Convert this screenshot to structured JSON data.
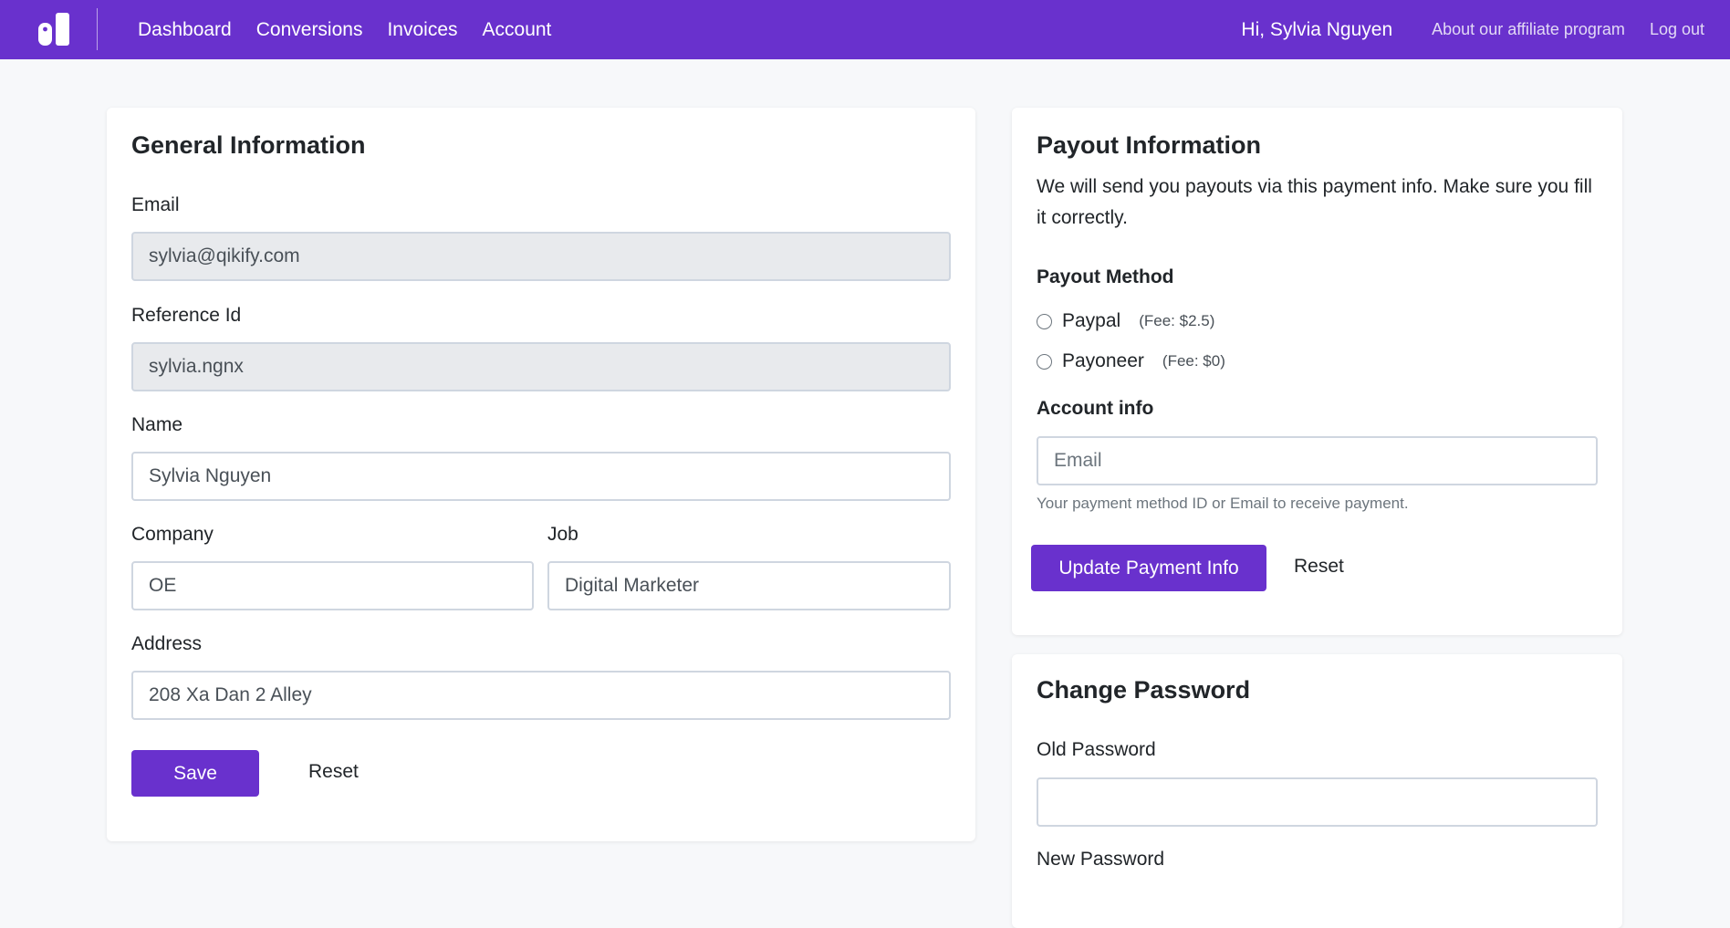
{
  "nav": {
    "links": [
      "Dashboard",
      "Conversions",
      "Invoices",
      "Account"
    ],
    "greeting": "Hi, Sylvia Nguyen",
    "affiliate_link": "About our affiliate program",
    "logout": "Log out"
  },
  "general": {
    "title": "General Information",
    "email_label": "Email",
    "email_value": "sylvia@qikify.com",
    "reference_label": "Reference Id",
    "reference_value": "sylvia.ngnx",
    "name_label": "Name",
    "name_value": "Sylvia Nguyen",
    "company_label": "Company",
    "company_value": "OE",
    "job_label": "Job",
    "job_value": "Digital Marketer",
    "address_label": "Address",
    "address_value": "208 Xa Dan 2 Alley",
    "save_label": "Save",
    "reset_label": "Reset"
  },
  "payout": {
    "title": "Payout Information",
    "description": "We will send you payouts via this payment info. Make sure you fill it correctly.",
    "method_label": "Payout Method",
    "methods": [
      {
        "label": "Paypal",
        "fee": "(Fee: $2.5)",
        "selected": false
      },
      {
        "label": "Payoneer",
        "fee": "(Fee: $0)",
        "selected": false
      }
    ],
    "account_label": "Account info",
    "account_placeholder": "Email",
    "account_help": "Your payment method ID or Email to receive payment.",
    "update_label": "Update Payment Info",
    "reset_label": "Reset"
  },
  "password": {
    "title": "Change Password",
    "old_label": "Old Password",
    "new_label": "New Password"
  },
  "colors": {
    "brand": "#6931cd",
    "page_background": "#f7f8fa",
    "readonly_input": "#e8eaed"
  }
}
